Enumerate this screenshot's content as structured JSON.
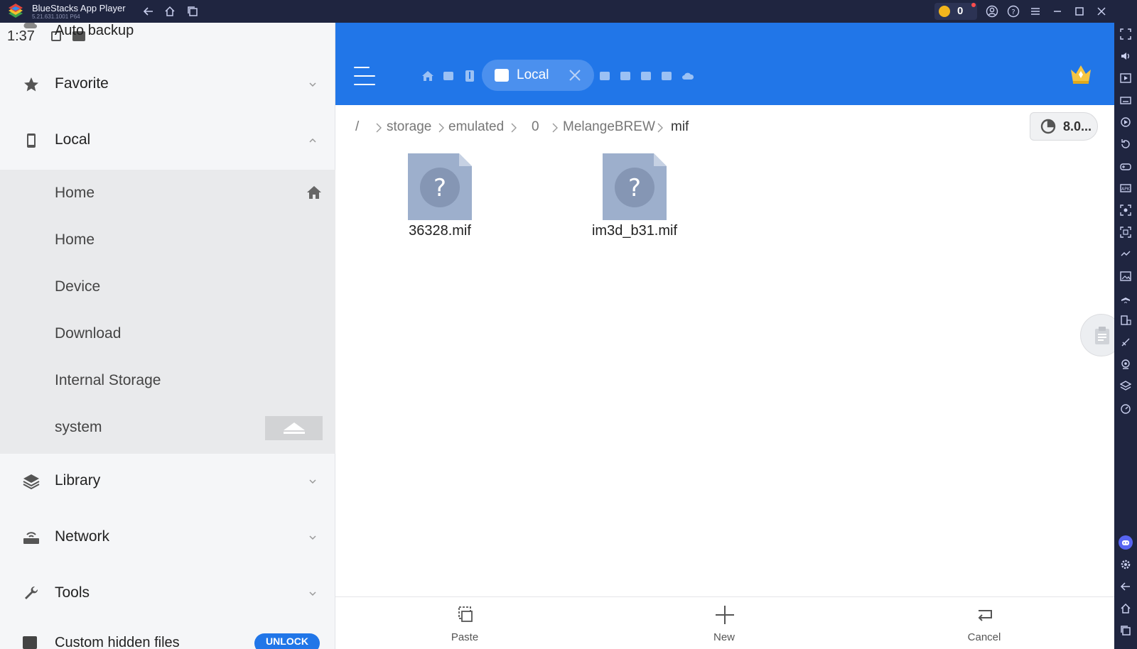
{
  "titlebar": {
    "app_name": "BlueStacks App Player",
    "app_version": "5.21.631.1001 P64",
    "coins": "0"
  },
  "status": {
    "time": "1:37",
    "notification_text": "Auto backup"
  },
  "drawer": {
    "sections": {
      "favorite": "Favorite",
      "local": "Local",
      "library": "Library",
      "network": "Network",
      "tools": "Tools"
    },
    "local_items": [
      "Home",
      "Home",
      "Device",
      "Download",
      "Internal Storage",
      "system"
    ],
    "unlock_label": "Custom hidden files",
    "unlock_button": "UNLOCK"
  },
  "appbar": {
    "active_tab": "Local",
    "accent_color": "#2176e8"
  },
  "path": {
    "root": "/",
    "segments": [
      "storage",
      "emulated",
      "0",
      "MelangeBREW",
      "mif"
    ],
    "storage_label": "8.0..."
  },
  "files": [
    {
      "name": "36328.mif",
      "icon": "unknown-file-icon"
    },
    {
      "name": "im3d_b31.mif",
      "icon": "unknown-file-icon"
    }
  ],
  "bottombar": {
    "paste": "Paste",
    "new": "New",
    "cancel": "Cancel"
  }
}
